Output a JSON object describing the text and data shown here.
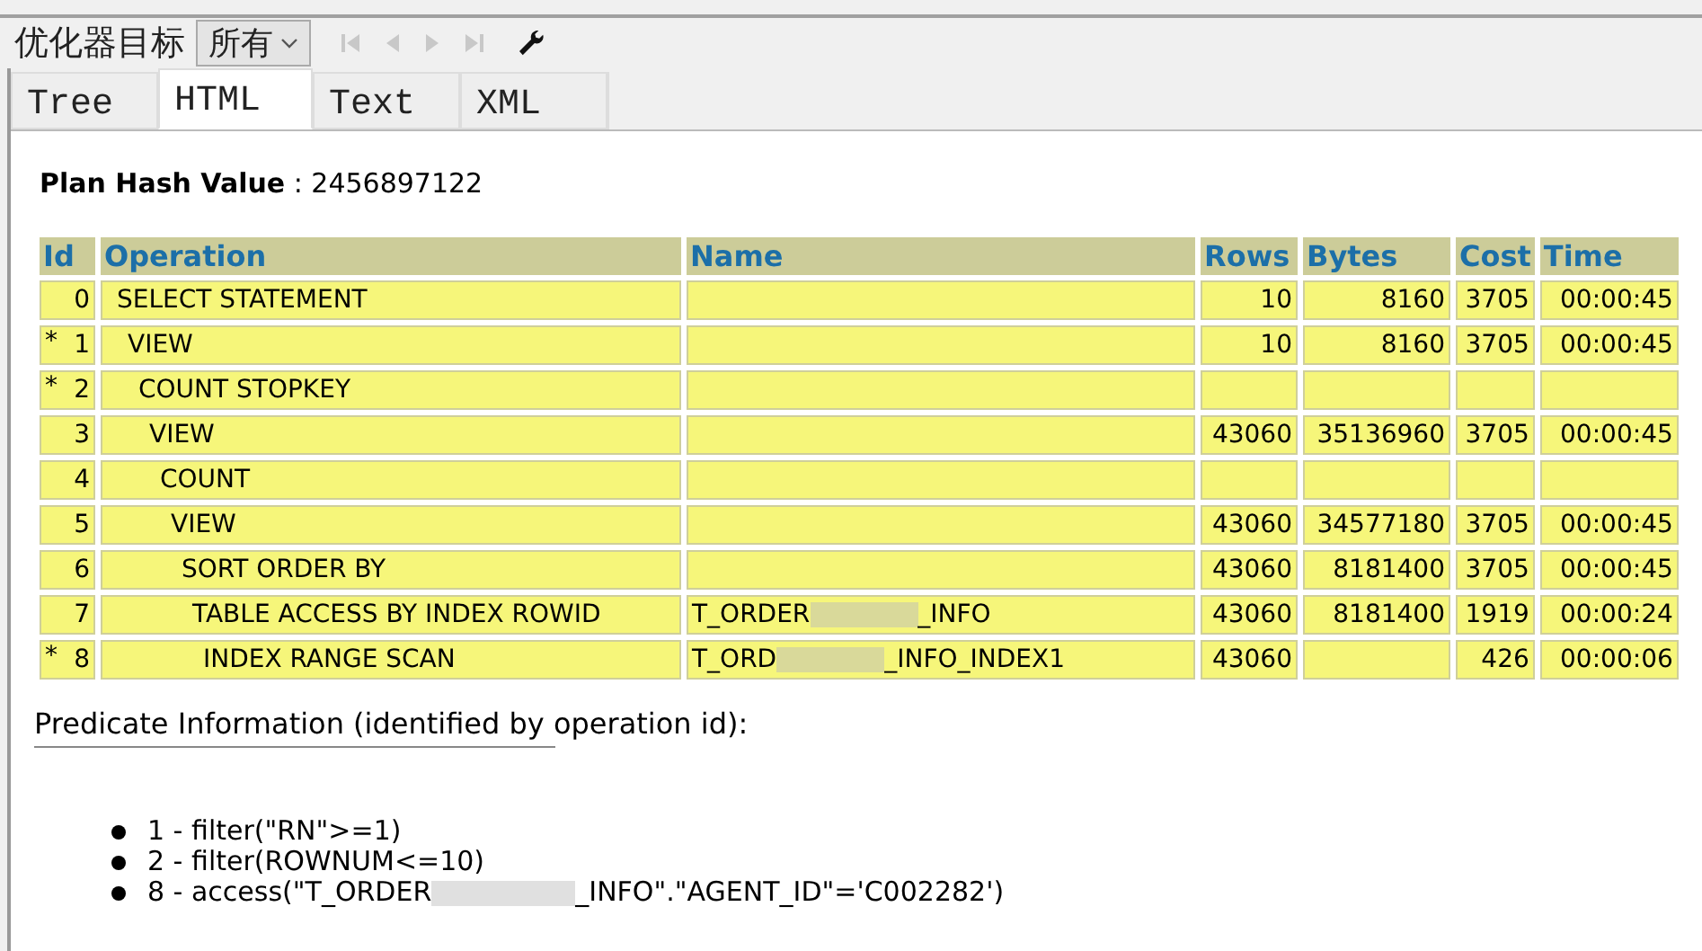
{
  "toolbar": {
    "label": "优化器目标",
    "dropdown": {
      "value": "所有"
    },
    "nav_buttons": [
      {
        "kind": "first",
        "disabled": true
      },
      {
        "kind": "prev",
        "disabled": true
      },
      {
        "kind": "next",
        "disabled": true
      },
      {
        "kind": "last",
        "disabled": true
      }
    ]
  },
  "tabs": [
    {
      "label": "Tree",
      "selected": false
    },
    {
      "label": "HTML",
      "selected": true
    },
    {
      "label": "Text",
      "selected": false
    },
    {
      "label": "XML",
      "selected": false
    }
  ],
  "plan_hash": {
    "label": "Plan Hash Value",
    "separator": ":",
    "value": "2456897122"
  },
  "table": {
    "columns": [
      "Id",
      "Operation",
      "Name",
      "Rows",
      "Bytes",
      "Cost",
      "Time"
    ],
    "rows": [
      {
        "id": "0",
        "operation": "SELECT STATEMENT",
        "rows": "10",
        "bytes": "8160",
        "cost": "3705",
        "time": "00:00:45",
        "children": [
          {
            "marker": "*",
            "id": "1",
            "operation": "VIEW",
            "rows": "10",
            "bytes": "8160",
            "cost": "3705",
            "time": "00:00:45",
            "children": [
              {
                "marker": "*",
                "id": "2",
                "operation": "COUNT STOPKEY",
                "children": [
                  {
                    "id": "3",
                    "operation": "VIEW",
                    "rows": "43060",
                    "bytes": "35136960",
                    "cost": "3705",
                    "time": "00:00:45",
                    "children": [
                      {
                        "id": "4",
                        "operation": "COUNT",
                        "children": [
                          {
                            "id": "5",
                            "operation": "VIEW",
                            "rows": "43060",
                            "bytes": "34577180",
                            "cost": "3705",
                            "time": "00:00:45",
                            "children": [
                              {
                                "id": "6",
                                "operation": "SORT ORDER BY",
                                "rows": "43060",
                                "bytes": "8181400",
                                "cost": "3705",
                                "time": "00:00:45",
                                "children": [
                                  {
                                    "id": "7",
                                    "operation": "TABLE ACCESS BY INDEX ROWID",
                                    "name": [
                                      "T_ORDER",
                                      "_INFO"
                                    ],
                                    "rows": "43060",
                                    "bytes": "8181400",
                                    "cost": "1919",
                                    "time": "00:00:24",
                                    "children": [
                                      {
                                        "marker": "*",
                                        "id": "8",
                                        "operation": "INDEX RANGE SCAN",
                                        "name": [
                                          "T_ORD",
                                          "_INFO_INDEX1"
                                        ],
                                        "rows": "43060",
                                        "cost": "426",
                                        "time": "00:00:06"
                                      }
                                    ]
                                  }
                                ]
                              }
                            ]
                          }
                        ]
                      }
                    ]
                  }
                ]
              }
            ]
          }
        ]
      }
    ]
  },
  "predicates": {
    "heading": "Predicate Information (identified by operation id):",
    "items": [
      {
        "parts": [
          "1 - filter(\"RN\">=1)"
        ]
      },
      {
        "parts": [
          "2 - filter(ROWNUM<=10)"
        ]
      },
      {
        "parts": [
          "8 - access(\"T_ORDER",
          "_INFO\".\"AGENT_ID\"='C002282')"
        ]
      }
    ]
  }
}
